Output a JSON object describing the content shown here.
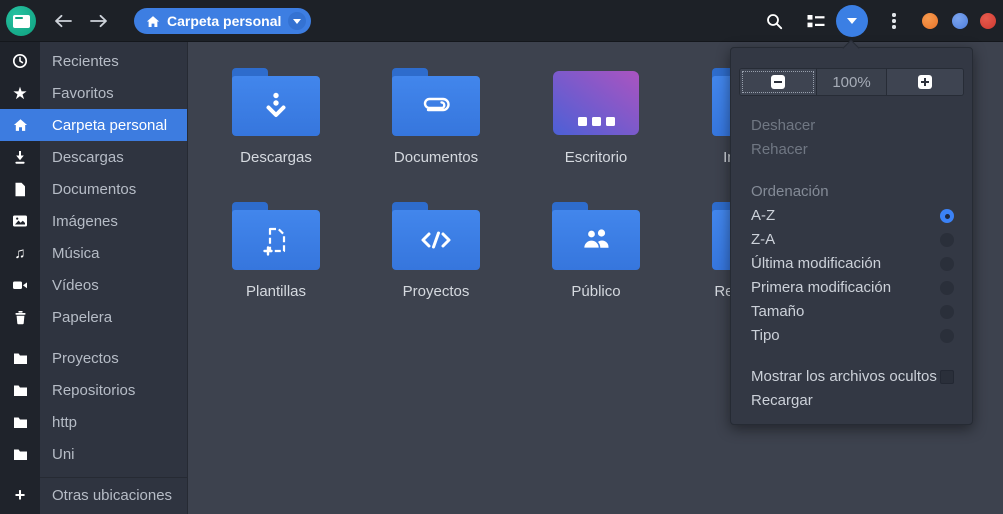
{
  "topbar": {
    "location_label": "Carpeta personal",
    "accent_color": "#3d7ce0",
    "window_controls": {
      "minimize_color": "#e8742a",
      "maximize_color": "#4f7fdd",
      "close_color": "#cf3a31"
    }
  },
  "sidebar": {
    "items": [
      {
        "label": "Recientes",
        "icon": "clock-icon",
        "selected": false
      },
      {
        "label": "Favoritos",
        "icon": "star-icon",
        "selected": false
      },
      {
        "label": "Carpeta personal",
        "icon": "home-icon",
        "selected": true
      },
      {
        "label": "Descargas",
        "icon": "download-icon",
        "selected": false
      },
      {
        "label": "Documentos",
        "icon": "document-icon",
        "selected": false
      },
      {
        "label": "Imágenes",
        "icon": "image-icon",
        "selected": false
      },
      {
        "label": "Música",
        "icon": "music-icon",
        "selected": false
      },
      {
        "label": "Vídeos",
        "icon": "video-icon",
        "selected": false
      },
      {
        "label": "Papelera",
        "icon": "trash-icon",
        "selected": false
      },
      {
        "label": "Proyectos",
        "icon": "folder-icon",
        "selected": false
      },
      {
        "label": "Repositorios",
        "icon": "folder-icon",
        "selected": false
      },
      {
        "label": "http",
        "icon": "folder-icon",
        "selected": false
      },
      {
        "label": "Uni",
        "icon": "folder-icon",
        "selected": false
      },
      {
        "label": "Otras ubicaciones",
        "icon": "plus-icon",
        "selected": false
      }
    ]
  },
  "content": {
    "folders": [
      {
        "name": "Descargas",
        "emblem": "download"
      },
      {
        "name": "Documentos",
        "emblem": "paperclip"
      },
      {
        "name": "Escritorio",
        "emblem": "desktop"
      },
      {
        "name": "Imágenes",
        "emblem": "hidden-behind-menu"
      },
      {
        "name": "Plantillas",
        "emblem": "template"
      },
      {
        "name": "Proyectos",
        "emblem": "code"
      },
      {
        "name": "Público",
        "emblem": "people"
      },
      {
        "name": "Repositorios",
        "emblem": "hidden-behind-menu"
      }
    ]
  },
  "menu": {
    "zoom_value": "100%",
    "undo_label": "Deshacer",
    "redo_label": "Rehacer",
    "sort_header": "Ordenación",
    "sort_options": [
      {
        "label": "A-Z",
        "selected": true
      },
      {
        "label": "Z-A",
        "selected": false
      },
      {
        "label": "Última modificación",
        "selected": false
      },
      {
        "label": "Primera modificación",
        "selected": false
      },
      {
        "label": "Tamaño",
        "selected": false
      },
      {
        "label": "Tipo",
        "selected": false
      }
    ],
    "show_hidden_label": "Mostrar los archivos ocultos",
    "show_hidden_checked": false,
    "reload_label": "Recargar"
  }
}
